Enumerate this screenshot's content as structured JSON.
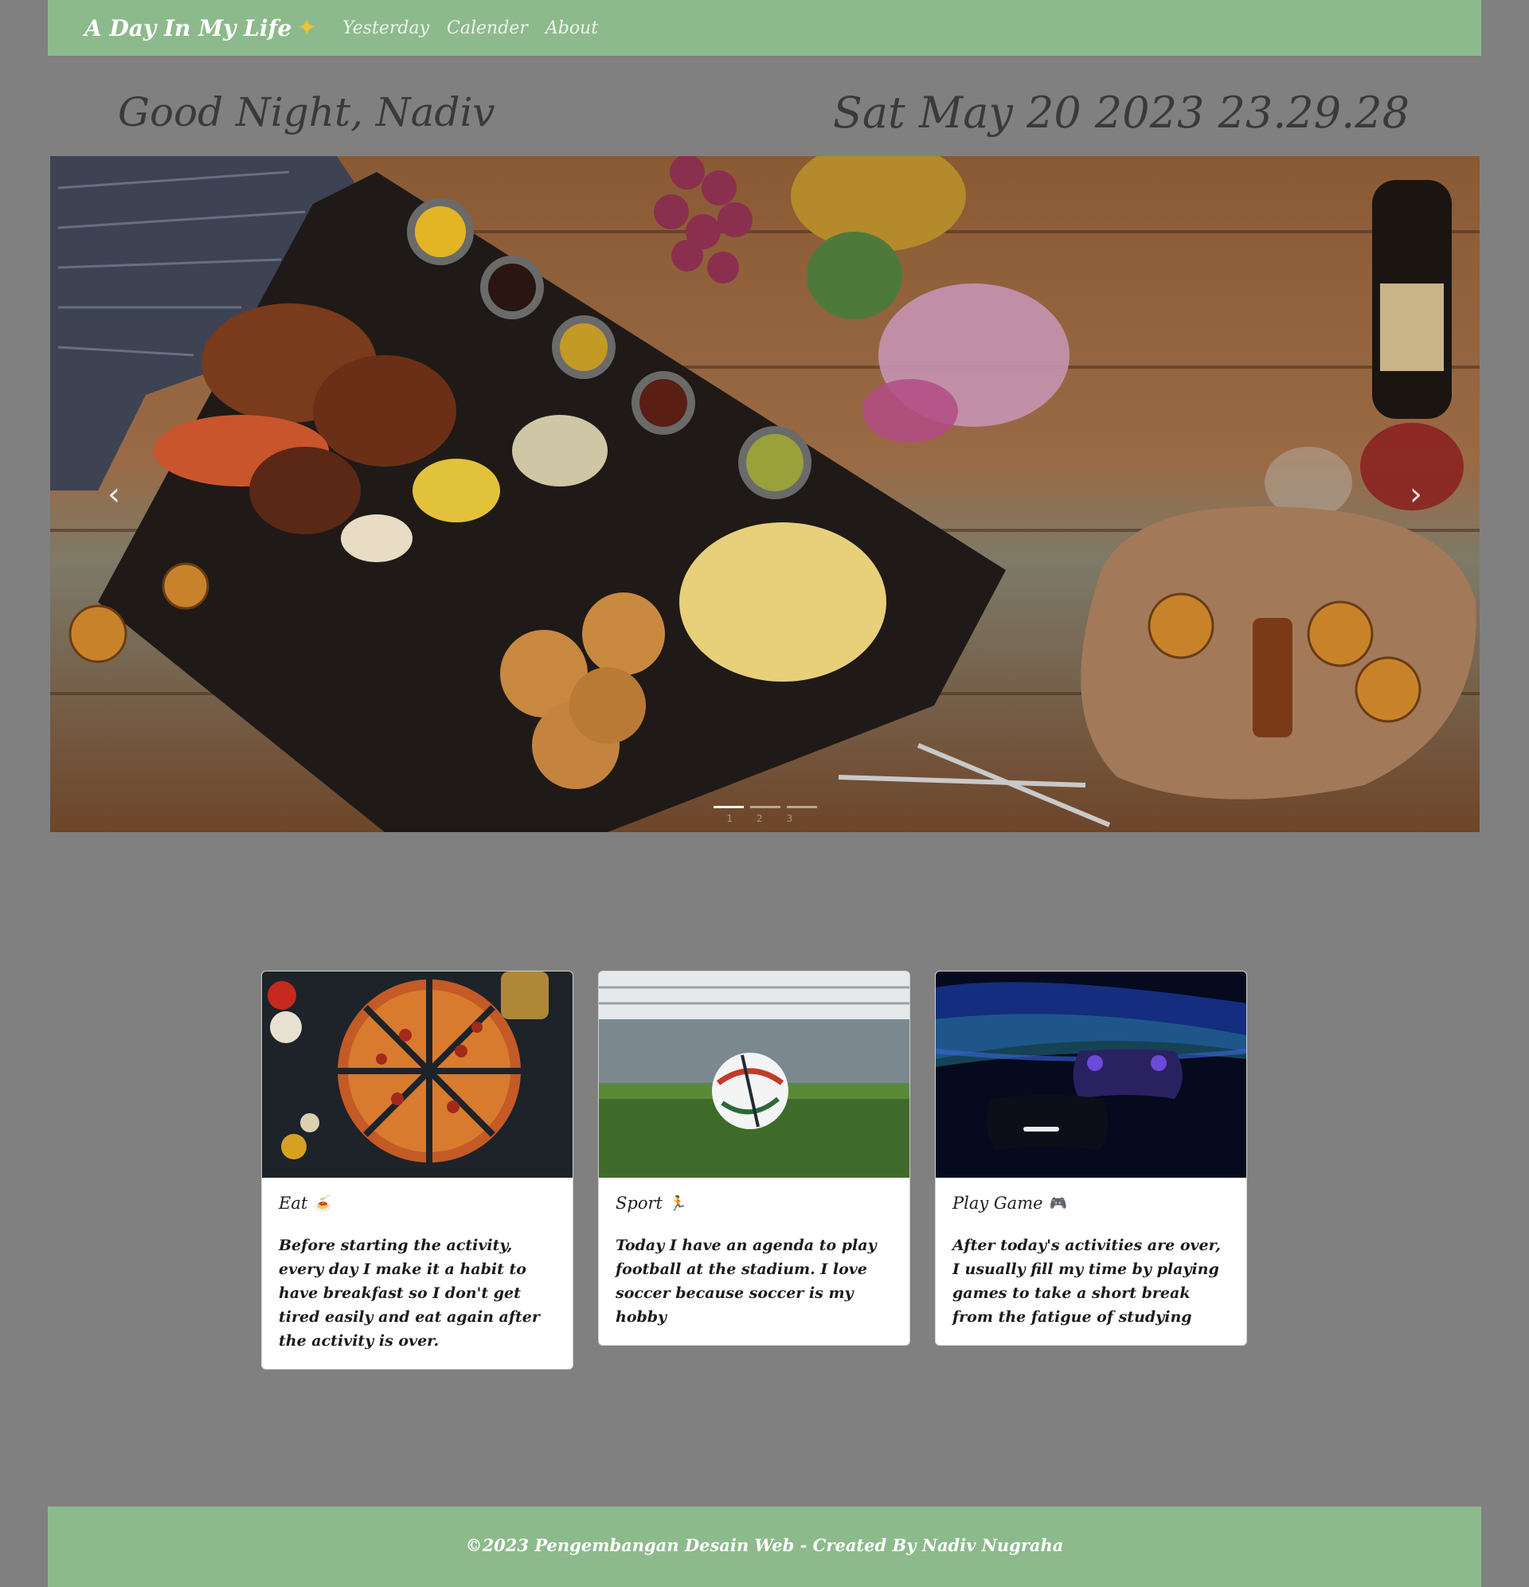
{
  "navbar": {
    "brand": "A Day In My Life",
    "brand_icon": "sparkles-icon",
    "links": [
      "Yesterday",
      "Calender",
      "About"
    ]
  },
  "header": {
    "greeting": "Good Night, Nadiv",
    "datetime": "Sat May 20 2023 23.29.28"
  },
  "carousel": {
    "prev_label": "‹",
    "next_label": "›",
    "indicator_labels": [
      "1",
      "2",
      "3"
    ],
    "active_index": 0
  },
  "cards": [
    {
      "title": "Eat",
      "emoji": "🍝",
      "text": "Before starting the activity, every day I make it a habit to have breakfast so I don't get tired easily and eat again after the activity is over."
    },
    {
      "title": "Sport",
      "emoji": "🏃",
      "text": "Today I have an agenda to play football at the stadium. I love soccer because soccer is my hobby"
    },
    {
      "title": "Play Game",
      "emoji": "🎮",
      "text": "After today's activities are over, I usually fill my time by playing games to take a short break from the fatigue of studying"
    }
  ],
  "footer": {
    "text": "©2023 Pengembangan Desain Web - Created By Nadiv Nugraha"
  },
  "colors": {
    "background": "#808080",
    "navbar": "#8dba8c",
    "footer": "#8dba8c"
  }
}
